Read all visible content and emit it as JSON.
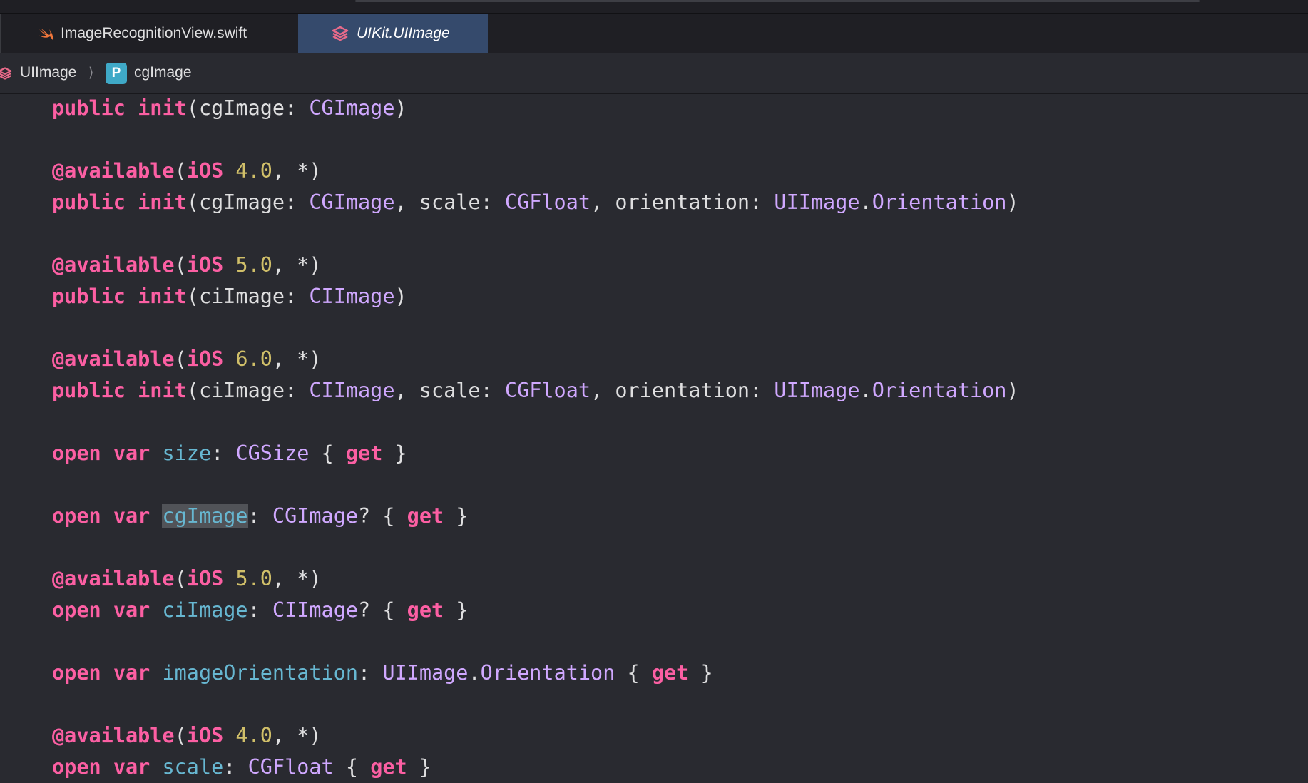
{
  "tabs": [
    {
      "label": "ImageRecognitionView.swift",
      "icon": "swift-icon",
      "active": false
    },
    {
      "label": "UIKit.UIImage",
      "icon": "module-icon",
      "active": true
    }
  ],
  "breadcrumb": {
    "items": [
      "UIImage",
      "cgImage"
    ],
    "separator": "⟩",
    "property_badge": "P"
  },
  "code": {
    "lines": [
      {
        "kw1": "public",
        "kw2": "init",
        "open": "(",
        "a1": "cgImage: ",
        "t1": "CGImage",
        "close": ")"
      },
      {
        "attr": "@available",
        "open": "(",
        "plat": "iOS",
        "ver": "4.0",
        "rest": ", *)"
      },
      {
        "kw1": "public",
        "kw2": "init",
        "open": "(",
        "a1": "cgImage: ",
        "t1": "CGImage",
        "a2": ", scale: ",
        "t2": "CGFloat",
        "a3": ", orientation: ",
        "t3": "UIImage",
        "dot": ".",
        "t4": "Orientation",
        "close": ")"
      },
      {
        "attr": "@available",
        "open": "(",
        "plat": "iOS",
        "ver": "5.0",
        "rest": ", *)"
      },
      {
        "kw1": "public",
        "kw2": "init",
        "open": "(",
        "a1": "ciImage: ",
        "t1": "CIImage",
        "close": ")"
      },
      {
        "attr": "@available",
        "open": "(",
        "plat": "iOS",
        "ver": "6.0",
        "rest": ", *)"
      },
      {
        "kw1": "public",
        "kw2": "init",
        "open": "(",
        "a1": "ciImage: ",
        "t1": "CIImage",
        "a2": ", scale: ",
        "t2": "CGFloat",
        "a3": ", orientation: ",
        "t3": "UIImage",
        "dot": ".",
        "t4": "Orientation",
        "close": ")"
      },
      {
        "kw1": "open",
        "kw2": "var",
        "name": "size",
        "colon": ": ",
        "type": "CGSize",
        "b1": " { ",
        "get": "get",
        "b2": " }"
      },
      {
        "kw1": "open",
        "kw2": "var",
        "name": "cgImage",
        "colon": ": ",
        "type": "CGImage",
        "opt": "? { ",
        "get": "get",
        "b2": " }"
      },
      {
        "attr": "@available",
        "open": "(",
        "plat": "iOS",
        "ver": "5.0",
        "rest": ", *)"
      },
      {
        "kw1": "open",
        "kw2": "var",
        "name": "ciImage",
        "colon": ": ",
        "type": "CIImage",
        "opt": "? { ",
        "get": "get",
        "b2": " }"
      },
      {
        "kw1": "open",
        "kw2": "var",
        "name": "imageOrientation",
        "colon": ": ",
        "type": "UIImage",
        "dot": ".",
        "type2": "Orientation",
        "b1": " { ",
        "get": "get",
        "b2": " }"
      },
      {
        "attr": "@available",
        "open": "(",
        "plat": "iOS",
        "ver": "4.0",
        "rest": ", *)"
      },
      {
        "kw1": "open",
        "kw2": "var",
        "name": "scale",
        "colon": ": ",
        "type": "CGFloat",
        "b1": " { ",
        "get": "get",
        "b2": " }"
      }
    ]
  },
  "colors": {
    "background": "#292a30",
    "keyword": "#fc5fa3",
    "type": "#d0a8ff",
    "number": "#d0bf69",
    "property": "#67b7d1",
    "plain": "#dfdfe0",
    "active_tab": "#354a6c",
    "highlight": "#515358"
  }
}
